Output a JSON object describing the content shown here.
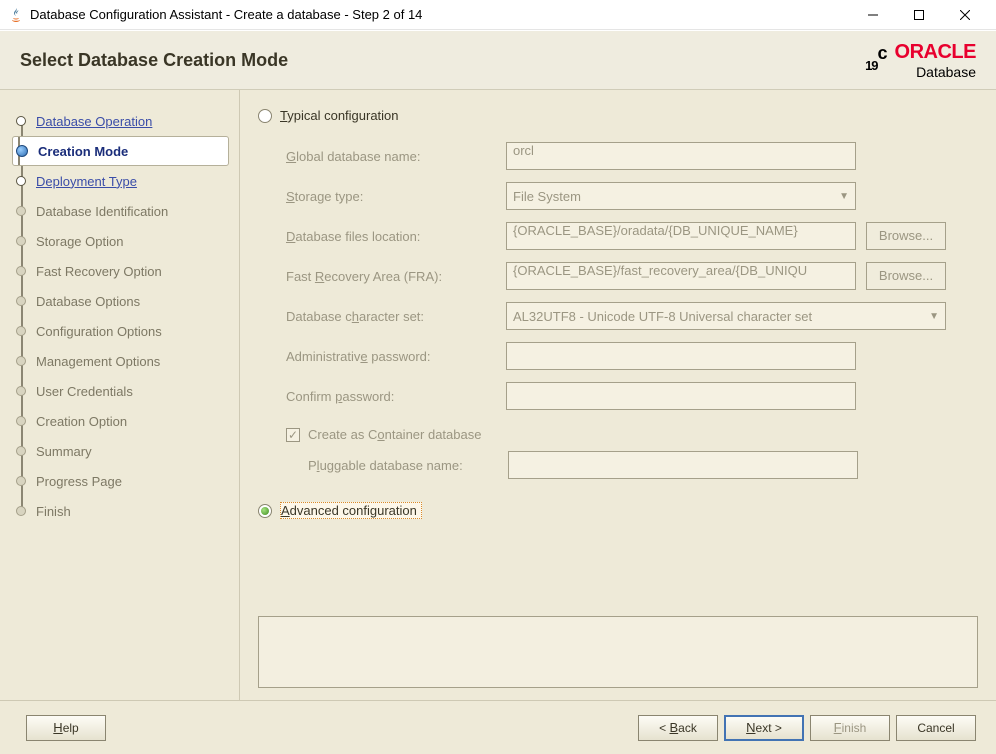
{
  "window": {
    "title": "Database Configuration Assistant - Create a database - Step 2 of 14"
  },
  "header": {
    "title": "Select Database Creation Mode",
    "logo_version": "19",
    "logo_version_sup": "c",
    "logo_brand": "ORACLE",
    "logo_product": "Database"
  },
  "sidebar": {
    "steps": [
      {
        "label": "Database Operation"
      },
      {
        "label": "Creation Mode"
      },
      {
        "label": "Deployment Type"
      },
      {
        "label": "Database Identification"
      },
      {
        "label": "Storage Option"
      },
      {
        "label": "Fast Recovery Option"
      },
      {
        "label": "Database Options"
      },
      {
        "label": "Configuration Options"
      },
      {
        "label": "Management Options"
      },
      {
        "label": "User Credentials"
      },
      {
        "label": "Creation Option"
      },
      {
        "label": "Summary"
      },
      {
        "label": "Progress Page"
      },
      {
        "label": "Finish"
      }
    ]
  },
  "form": {
    "typical_label": "Typical configuration",
    "advanced_label": "Advanced configuration",
    "global_db_label": "Global database name:",
    "global_db_value": "orcl",
    "storage_type_label": "Storage type:",
    "storage_type_value": "File System",
    "db_files_label": "Database files location:",
    "db_files_value": "{ORACLE_BASE}/oradata/{DB_UNIQUE_NAME}",
    "fra_label": "Fast Recovery Area (FRA):",
    "fra_value": "{ORACLE_BASE}/fast_recovery_area/{DB_UNIQU",
    "charset_label": "Database character set:",
    "charset_value": "AL32UTF8 - Unicode UTF-8 Universal character set",
    "admin_pwd_label": "Administrative password:",
    "confirm_pwd_label": "Confirm password:",
    "container_label": "Create as Container database",
    "pluggable_label": "Pluggable database name:",
    "browse_label": "Browse..."
  },
  "footer": {
    "help": "Help",
    "back": "< Back",
    "next": "Next >",
    "finish": "Finish",
    "cancel": "Cancel"
  }
}
